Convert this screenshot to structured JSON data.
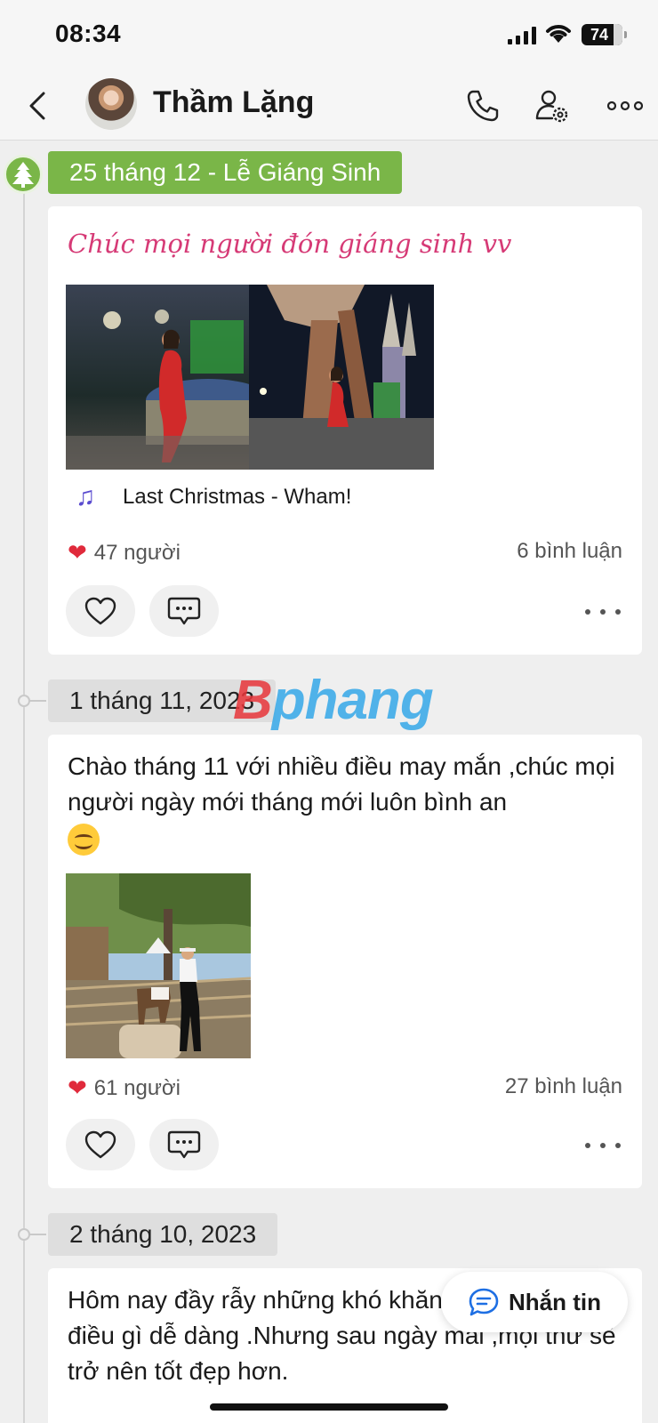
{
  "status_bar": {
    "time": "08:34",
    "battery": "74"
  },
  "header": {
    "contact_name": "Thầm Lặng",
    "icons": [
      "back-chevron-icon",
      "phone-icon",
      "user-settings-icon",
      "more-icon"
    ]
  },
  "posts": [
    {
      "date": "25 tháng 12 - Lễ Giáng Sinh",
      "holiday_icon": "christmas-tree-icon",
      "text": "Chúc mọi người đón giáng sinh vv",
      "music": "Last Christmas - Wham!",
      "likes": "47 người",
      "comments": "6 bình luận"
    },
    {
      "date": "1 tháng 11, 2023",
      "text": "Chào tháng 11 với nhiều điều may mắn ,chúc mọi người ngày mới tháng mới luôn bình an",
      "likes": "61 người",
      "comments": "27 bình luận"
    },
    {
      "date": "2 tháng 10, 2023",
      "text": "Hôm nay đầy rẫy những khó khăn, cũng kg có điều gì dễ dàng .Nhưng sau ngày mai ,mọi thứ sẽ trở nên tốt đẹp hơn."
    }
  ],
  "watermark": {
    "b": "B",
    "rest": "phang"
  },
  "message_button": {
    "label": "Nhắn tin"
  },
  "colors": {
    "holiday_green": "#7ab648",
    "accent_blue": "#1e6fe3",
    "pink_text": "#d63a76",
    "heart_red": "#e02a3b"
  }
}
